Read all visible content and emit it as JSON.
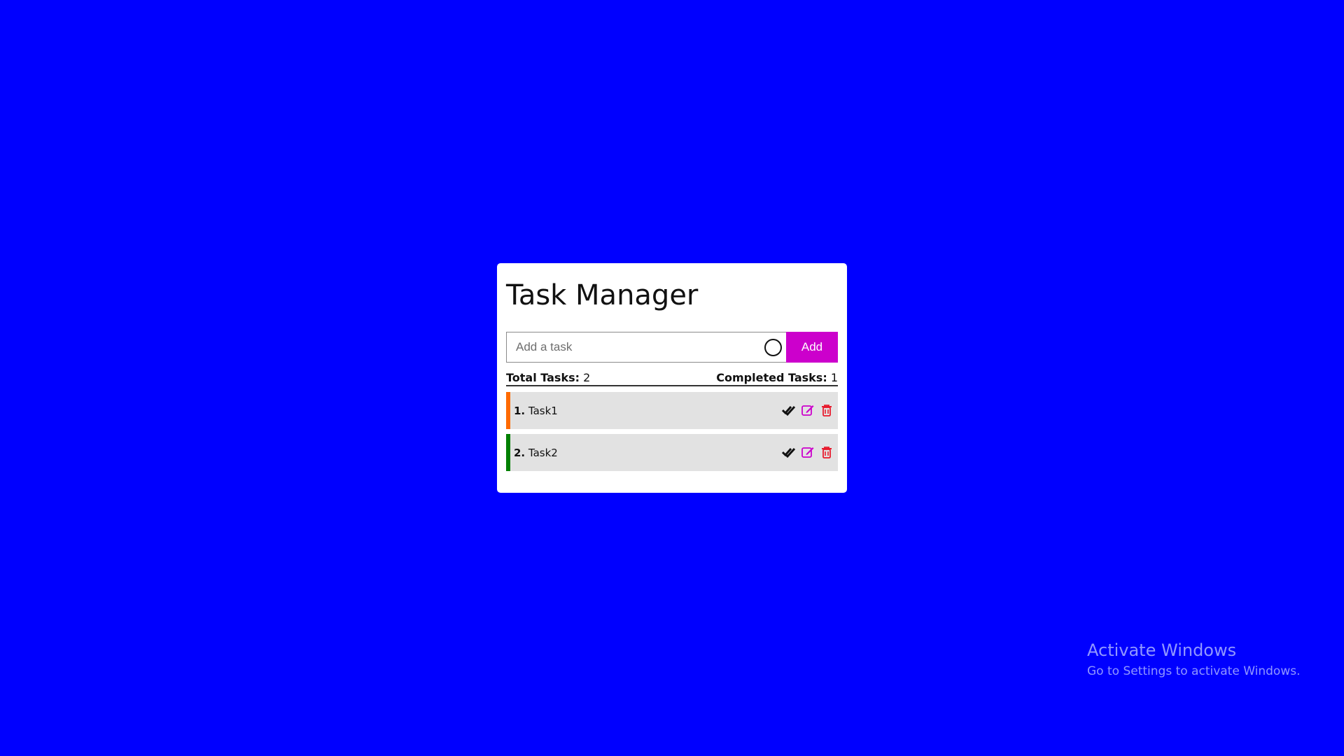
{
  "app": {
    "title": "Task Manager"
  },
  "input": {
    "placeholder": "Add a task",
    "value": ""
  },
  "add_button_label": "Add",
  "stats": {
    "total_label": "Total Tasks:",
    "total_value": "2",
    "completed_label": "Completed Tasks:",
    "completed_value": "1"
  },
  "tasks": [
    {
      "number": "1.",
      "text": "Task1",
      "stripe_color": "#ff6a00"
    },
    {
      "number": "2.",
      "text": "Task2",
      "stripe_color": "#008000"
    }
  ],
  "icons": {
    "complete": "double-check-icon",
    "edit": "edit-icon",
    "delete": "trash-icon",
    "input_status": "circle-icon"
  },
  "colors": {
    "background": "#0000ff",
    "accent": "#cc00cc",
    "delete": "#e8192c",
    "edit": "#cc00cc"
  },
  "watermark": {
    "title": "Activate Windows",
    "subtitle": "Go to Settings to activate Windows."
  }
}
